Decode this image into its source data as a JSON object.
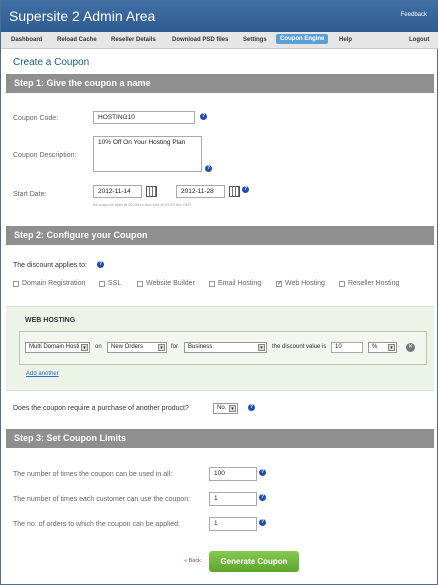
{
  "header": {
    "title": "Supersite 2 Admin Area",
    "feedback": "Feedback"
  },
  "nav": [
    {
      "label": "Dashboard"
    },
    {
      "label": "Reload Cache"
    },
    {
      "label": "Reseller Details"
    },
    {
      "label": "Download PSD files"
    },
    {
      "label": "Settings"
    },
    {
      "label": "Coupon Engine",
      "active": true
    },
    {
      "label": "Help"
    },
    {
      "label": "Logout"
    }
  ],
  "page": {
    "title": "Create a Coupon"
  },
  "step1": {
    "heading": "Step 1: Give the coupon a name",
    "code_label": "Coupon Code:",
    "code_value": "HOSTING10",
    "desc_label": "Coupon Description:",
    "desc_value": "10% Off On Your Hosting Plan",
    "start_label": "Start Date:",
    "start_value": "2012-11-14",
    "end_value": "2012-11-28",
    "date_note": "All coupons start at 00:00hrs and end at 24:00 hrs GMT"
  },
  "step2": {
    "heading": "Step 2: Configure your Coupon",
    "applies_label": "The discount applies to:",
    "products": [
      {
        "label": "Domain Registration",
        "checked": false
      },
      {
        "label": "SSL",
        "checked": false
      },
      {
        "label": "Website Builder",
        "checked": false
      },
      {
        "label": "Email Hosting",
        "checked": false
      },
      {
        "label": "Web Hosting",
        "checked": true
      },
      {
        "label": "Reseller Hosting",
        "checked": false
      }
    ],
    "web_hosting": {
      "heading": "WEB HOSTING",
      "plan": "Multi Domain Hosti",
      "on_label": "on",
      "orders": "New Orders",
      "for_label": "for",
      "tier": "Business",
      "value_label": "the discount value is",
      "value": "10",
      "unit": "%",
      "add_another": "Add another"
    },
    "requires_label": "Does the coupon require a purchase of another product?",
    "requires_value": "No."
  },
  "step3": {
    "heading": "Step 3: Set Coupon Limits",
    "limits": [
      {
        "label": "The number of times the coupon can be used in all:",
        "value": "100"
      },
      {
        "label": "The number of times each customer can use the coupon:",
        "value": "1"
      },
      {
        "label": "The no. of orders to which the coupon can be applied:",
        "value": "1"
      }
    ]
  },
  "footer": {
    "back": "« Back",
    "generate": "Generate Coupon"
  },
  "colors": {
    "header": "#3469a0",
    "active_tab": "#5a9fd6",
    "step_bar": "#8f8f8f",
    "generate": "#6fb43a",
    "web_hosting_bg": "#ecf4e8"
  }
}
